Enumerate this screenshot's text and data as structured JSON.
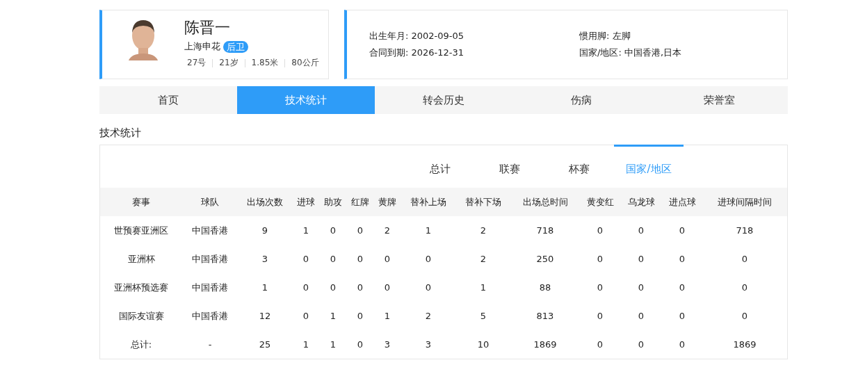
{
  "player": {
    "photo": {
      "kind": "picture"
    },
    "name": "陈晋一",
    "club": "上海申花",
    "position": "后卫",
    "facts": [
      "27号",
      "21岁",
      "1.85米",
      "80公斤"
    ]
  },
  "details": [
    "出生年月: 2002-09-05",
    "惯用脚: 左脚",
    "合同到期: 2026-12-31",
    "国家/地区: 中国香港,日本"
  ],
  "tabs": [
    {
      "label": "首页",
      "selected": false
    },
    {
      "label": "技术统计",
      "selected": true
    },
    {
      "label": "转会历史",
      "selected": false
    },
    {
      "label": "伤病",
      "selected": false
    },
    {
      "label": "荣誉室",
      "selected": false
    }
  ],
  "section_title": "技术统计",
  "subtabs": [
    {
      "label": "总计",
      "selected": false
    },
    {
      "label": "联赛",
      "selected": false
    },
    {
      "label": "杯赛",
      "selected": false
    },
    {
      "label": "国家/地区",
      "selected": true
    }
  ],
  "table": {
    "columns": [
      "赛事",
      "球队",
      "出场次数",
      "进球",
      "助攻",
      "红牌",
      "黄牌",
      "替补上场",
      "替补下场",
      "出场总时间",
      "黄变红",
      "乌龙球",
      "进点球",
      "进球间隔时间"
    ],
    "rows": [
      [
        "世预赛亚洲区",
        "中国香港",
        "9",
        "1",
        "0",
        "0",
        "2",
        "1",
        "2",
        "718",
        "0",
        "0",
        "0",
        "718"
      ],
      [
        "亚洲杯",
        "中国香港",
        "3",
        "0",
        "0",
        "0",
        "0",
        "0",
        "2",
        "250",
        "0",
        "0",
        "0",
        "0"
      ],
      [
        "亚洲杯预选赛",
        "中国香港",
        "1",
        "0",
        "0",
        "0",
        "0",
        "0",
        "1",
        "88",
        "0",
        "0",
        "0",
        "0"
      ],
      [
        "国际友谊赛",
        "中国香港",
        "12",
        "0",
        "1",
        "0",
        "1",
        "2",
        "5",
        "813",
        "0",
        "0",
        "0",
        "0"
      ],
      [
        "总计:",
        "-",
        "25",
        "1",
        "1",
        "0",
        "3",
        "3",
        "10",
        "1869",
        "0",
        "0",
        "0",
        "1869"
      ]
    ]
  }
}
